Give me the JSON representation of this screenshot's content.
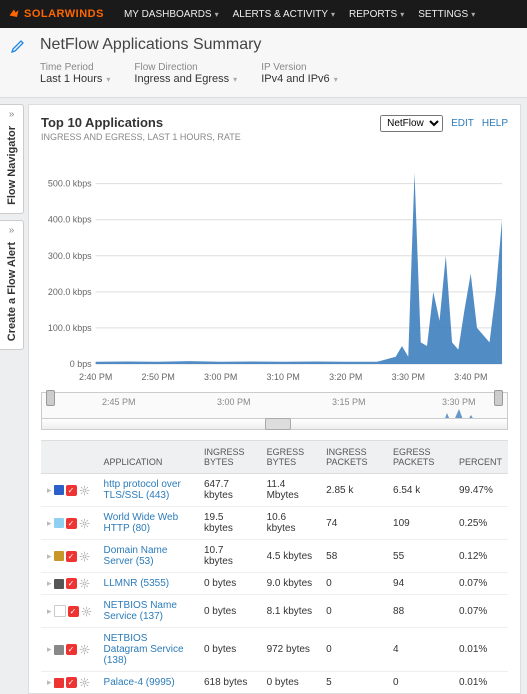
{
  "top": {
    "brand": "SOLARWINDS",
    "items": [
      "MY DASHBOARDS",
      "ALERTS & ACTIVITY",
      "REPORTS",
      "SETTINGS"
    ]
  },
  "page": {
    "title": "NetFlow Applications Summary",
    "filters": [
      {
        "label": "Time Period",
        "value": "Last 1 Hours"
      },
      {
        "label": "Flow Direction",
        "value": "Ingress and Egress"
      },
      {
        "label": "IP Version",
        "value": "IPv4 and IPv6"
      }
    ]
  },
  "side_tabs": {
    "nav": "Flow Navigator",
    "alert": "Create a Flow Alert",
    "chev": "»"
  },
  "panel": {
    "title": "Top 10 Applications",
    "subtitle": "INGRESS AND EGRESS, LAST 1 HOURS, RATE",
    "selector_value": "NetFlow",
    "edit": "EDIT",
    "help": "HELP"
  },
  "range_labels": [
    "2:45 PM",
    "3:00 PM",
    "3:15 PM",
    "3:30 PM"
  ],
  "chart_data": {
    "type": "area",
    "title": "Top 10 Applications",
    "xlabel": "",
    "ylabel": "",
    "y_ticks": [
      0,
      100,
      200,
      300,
      400,
      500
    ],
    "y_unit": "kbps",
    "x_ticks": [
      "2:40 PM",
      "2:50 PM",
      "3:00 PM",
      "3:10 PM",
      "3:20 PM",
      "3:30 PM",
      "3:40 PM"
    ],
    "ylim": [
      0,
      560
    ],
    "series": [
      {
        "name": "rate_kbps",
        "x_minutes_from_start": [
          0,
          5,
          10,
          15,
          20,
          25,
          30,
          35,
          40,
          45,
          48,
          49,
          50,
          51,
          52,
          53,
          54,
          55,
          56,
          57,
          58,
          59,
          60,
          61,
          62,
          63,
          64,
          65
        ],
        "values": [
          6,
          7,
          6,
          8,
          6,
          7,
          6,
          7,
          6,
          6,
          20,
          50,
          20,
          530,
          60,
          50,
          200,
          120,
          300,
          60,
          40,
          150,
          250,
          100,
          80,
          60,
          200,
          400
        ]
      }
    ]
  },
  "table": {
    "headers": [
      "APPLICATION",
      "INGRESS BYTES",
      "EGRESS BYTES",
      "INGRESS PACKETS",
      "EGRESS PACKETS",
      "PERCENT"
    ],
    "rows": [
      {
        "color": "#2b60c9",
        "app": "http protocol over TLS/SSL (443)",
        "ib": "647.7 kbytes",
        "eb": "11.4 Mbytes",
        "ip": "2.85 k",
        "ep": "6.54 k",
        "pct": "99.47%"
      },
      {
        "color": "#8fd0f2",
        "app": "World Wide Web HTTP (80)",
        "ib": "19.5 kbytes",
        "eb": "10.6 kbytes",
        "ip": "74",
        "ep": "109",
        "pct": "0.25%"
      },
      {
        "color": "#c9962b",
        "app": "Domain Name Server (53)",
        "ib": "10.7 kbytes",
        "eb": "4.5 kbytes",
        "ip": "58",
        "ep": "55",
        "pct": "0.12%"
      },
      {
        "color": "#555",
        "app": "LLMNR (5355)",
        "ib": "0 bytes",
        "eb": "9.0 kbytes",
        "ip": "0",
        "ep": "94",
        "pct": "0.07%"
      },
      {
        "color": "#fff",
        "app": "NETBIOS Name Service (137)",
        "ib": "0 bytes",
        "eb": "8.1 kbytes",
        "ip": "0",
        "ep": "88",
        "pct": "0.07%"
      },
      {
        "color": "#888",
        "app": "NETBIOS Datagram Service (138)",
        "ib": "0 bytes",
        "eb": "972 bytes",
        "ip": "0",
        "ep": "4",
        "pct": "0.01%"
      },
      {
        "color": "#e33",
        "app": "Palace-4 (9995)",
        "ib": "618 bytes",
        "eb": "0 bytes",
        "ip": "5",
        "ep": "0",
        "pct": "0.01%"
      }
    ]
  }
}
